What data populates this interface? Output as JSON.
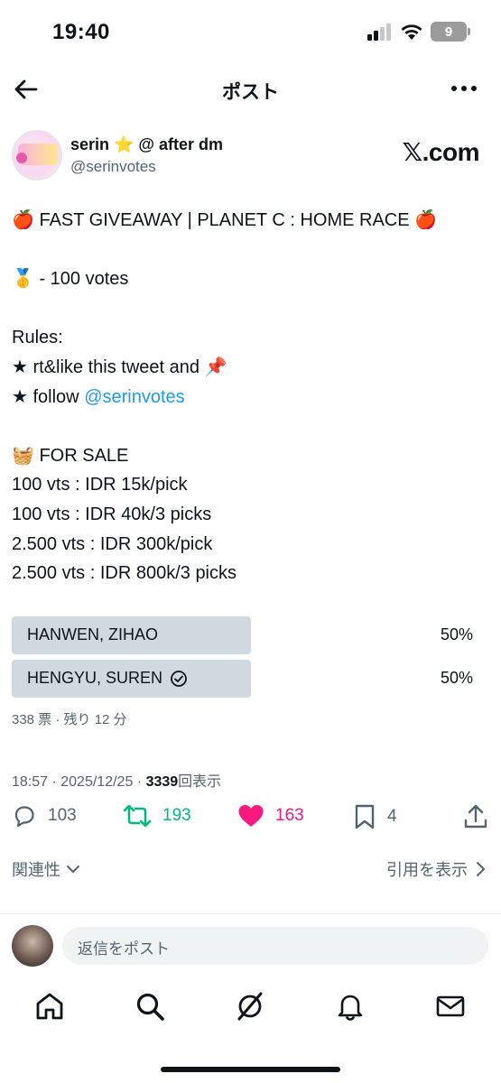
{
  "status_bar": {
    "time": "19:40",
    "battery": "9"
  },
  "header": {
    "title": "ポスト"
  },
  "author": {
    "name": "serin ⭐️ @ after dm",
    "handle": "@serinvotes",
    "brand": "𝕏.com"
  },
  "post": {
    "title_line": "🍎 FAST GIVEAWAY | PLANET C : HOME RACE 🍎",
    "prize_line": "🥇 - 100 votes",
    "rules_heading": "Rules:",
    "rule_1": "★ rt&like this tweet and 📌",
    "rule_2_prefix": "★ follow ",
    "rule_2_link": "@serinvotes",
    "sale_heading": "🧺 FOR SALE",
    "sale_1": "100 vts : IDR 15k/pick",
    "sale_2": "100 vts : IDR 40k/3 picks",
    "sale_3": "2.500 vts : IDR 300k/pick",
    "sale_4": "2.500 vts : IDR 800k/3 picks"
  },
  "poll": {
    "options": [
      {
        "label": "HANWEN, ZIHAO",
        "percent": "50%",
        "fill": 0.5,
        "selected": false
      },
      {
        "label": "HENGYU, SUREN",
        "percent": "50%",
        "fill": 0.5,
        "selected": true
      }
    ],
    "meta": "338 票 · 残り 12 分"
  },
  "post_meta": {
    "timestamp": "18:57 · 2025/12/25 · ",
    "views_count": "3339",
    "views_label": "回表示"
  },
  "actions": {
    "replies": "103",
    "reposts": "193",
    "likes": "163",
    "bookmarks": "4"
  },
  "colors": {
    "repost_green": "#00ba7c",
    "like_pink": "#f91880",
    "link_blue": "#1d9bf0",
    "secondary_text": "#536471"
  },
  "filters": {
    "sort_label": "関連性",
    "quotes_label": "引用を表示"
  },
  "reply": {
    "placeholder": "返信をポスト"
  },
  "icons": {
    "back": "back-arrow-icon",
    "more": "more-icon",
    "reply": "reply-icon",
    "repost": "repost-icon",
    "like": "heart-icon",
    "bookmark": "bookmark-icon",
    "share": "share-icon",
    "home": "home-icon",
    "search": "search-icon",
    "grok": "grok-icon",
    "notifications": "bell-icon",
    "messages": "mail-icon"
  }
}
